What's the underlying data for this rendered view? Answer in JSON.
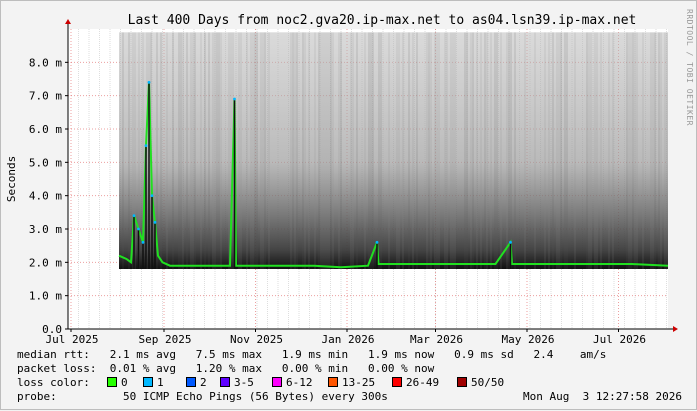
{
  "chart_data": {
    "type": "line",
    "title": "Last 400 Days from noc2.gva20.ip-max.net to as04.lsn39.ip-max.net",
    "ylabel": "Seconds",
    "ylim": [
      0,
      9
    ],
    "y_ticks": [
      {
        "v": 0,
        "label": "0.0"
      },
      {
        "v": 1,
        "label": "1.0 m"
      },
      {
        "v": 2,
        "label": "2.0 m"
      },
      {
        "v": 3,
        "label": "3.0 m"
      },
      {
        "v": 4,
        "label": "4.0 m"
      },
      {
        "v": 5,
        "label": "5.0 m"
      },
      {
        "v": 6,
        "label": "6.0 m"
      },
      {
        "v": 7,
        "label": "7.0 m"
      },
      {
        "v": 8,
        "label": "8.0 m"
      }
    ],
    "x_range": [
      "2025-06-29",
      "2026-08-03"
    ],
    "x_ticks": [
      {
        "date": "2025-07-01",
        "label": "Jul 2025"
      },
      {
        "date": "2025-09-01",
        "label": "Sep 2025"
      },
      {
        "date": "2025-11-01",
        "label": "Nov 2025"
      },
      {
        "date": "2026-01-01",
        "label": "Jan 2026"
      },
      {
        "date": "2026-03-01",
        "label": "Mar 2026"
      },
      {
        "date": "2026-05-01",
        "label": "May 2026"
      },
      {
        "date": "2026-07-01",
        "label": "Jul 2026"
      }
    ],
    "data_start": "2025-08-02",
    "grid": true,
    "series": [
      {
        "name": "median rtt",
        "unit": "ms",
        "points": [
          [
            "2025-08-02",
            2.2
          ],
          [
            "2025-08-07",
            2.1
          ],
          [
            "2025-08-10",
            2.0
          ],
          [
            "2025-08-12",
            3.4
          ],
          [
            "2025-08-15",
            3.0
          ],
          [
            "2025-08-18",
            2.6
          ],
          [
            "2025-08-20",
            5.5
          ],
          [
            "2025-08-22",
            7.4
          ],
          [
            "2025-08-24",
            4.0
          ],
          [
            "2025-08-26",
            3.2
          ],
          [
            "2025-08-28",
            2.2
          ],
          [
            "2025-08-31",
            2.0
          ],
          [
            "2025-09-05",
            1.9
          ],
          [
            "2025-09-15",
            1.9
          ],
          [
            "2025-09-30",
            1.9
          ],
          [
            "2025-10-15",
            1.9
          ],
          [
            "2025-10-18",
            6.9
          ],
          [
            "2025-10-19",
            1.9
          ],
          [
            "2025-11-01",
            1.9
          ],
          [
            "2025-11-20",
            1.9
          ],
          [
            "2025-12-10",
            1.9
          ],
          [
            "2025-12-28",
            1.85
          ],
          [
            "2026-01-15",
            1.9
          ],
          [
            "2026-01-21",
            2.6
          ],
          [
            "2026-01-22",
            1.95
          ],
          [
            "2026-02-10",
            1.95
          ],
          [
            "2026-03-01",
            1.95
          ],
          [
            "2026-03-20",
            1.95
          ],
          [
            "2026-04-10",
            1.95
          ],
          [
            "2026-04-20",
            2.6
          ],
          [
            "2026-04-21",
            1.95
          ],
          [
            "2026-05-10",
            1.95
          ],
          [
            "2026-06-01",
            1.95
          ],
          [
            "2026-06-20",
            1.95
          ],
          [
            "2026-07-10",
            1.95
          ],
          [
            "2026-08-03",
            1.9
          ]
        ],
        "color": "#20e020"
      }
    ],
    "smoke": {
      "description_of_scale": "grey band of ping spread per interval",
      "band_ms": [
        1.8,
        8.9
      ],
      "color": "#7a7a7a"
    }
  },
  "stats": {
    "median_rtt_line": "median rtt:   2.1 ms avg   7.5 ms max   1.9 ms min   1.9 ms now   0.9 ms sd   2.4    am/s",
    "packet_loss_line": "packet loss:  0.01 % avg   1.20 % max   0.00 % min   0.00 % now"
  },
  "legend": {
    "label": "loss color:",
    "items": [
      {
        "label": "0",
        "color": "#26ff00"
      },
      {
        "label": "1",
        "color": "#00b8ff"
      },
      {
        "label": "2",
        "color": "#0059ff"
      },
      {
        "label": "3-5",
        "color": "#5e00ff"
      },
      {
        "label": "6-12",
        "color": "#ff00ff"
      },
      {
        "label": "13-25",
        "color": "#ff5500"
      },
      {
        "label": "26-49",
        "color": "#ff0000"
      },
      {
        "label": "50/50",
        "color": "#a00000"
      }
    ]
  },
  "probe": {
    "label": "probe:",
    "text": "50 ICMP Echo Pings (56 Bytes) every 300s",
    "timestamp": "Mon Aug  3 12:27:58 2026"
  },
  "watermark": "RRDTOOL / TOBI OETIKER",
  "colors": {
    "background": "#f3f3f3",
    "plot_bg": "#ffffff",
    "grid_minor": "#dedede",
    "grid_major": "#e06060",
    "axis": "#000000"
  }
}
